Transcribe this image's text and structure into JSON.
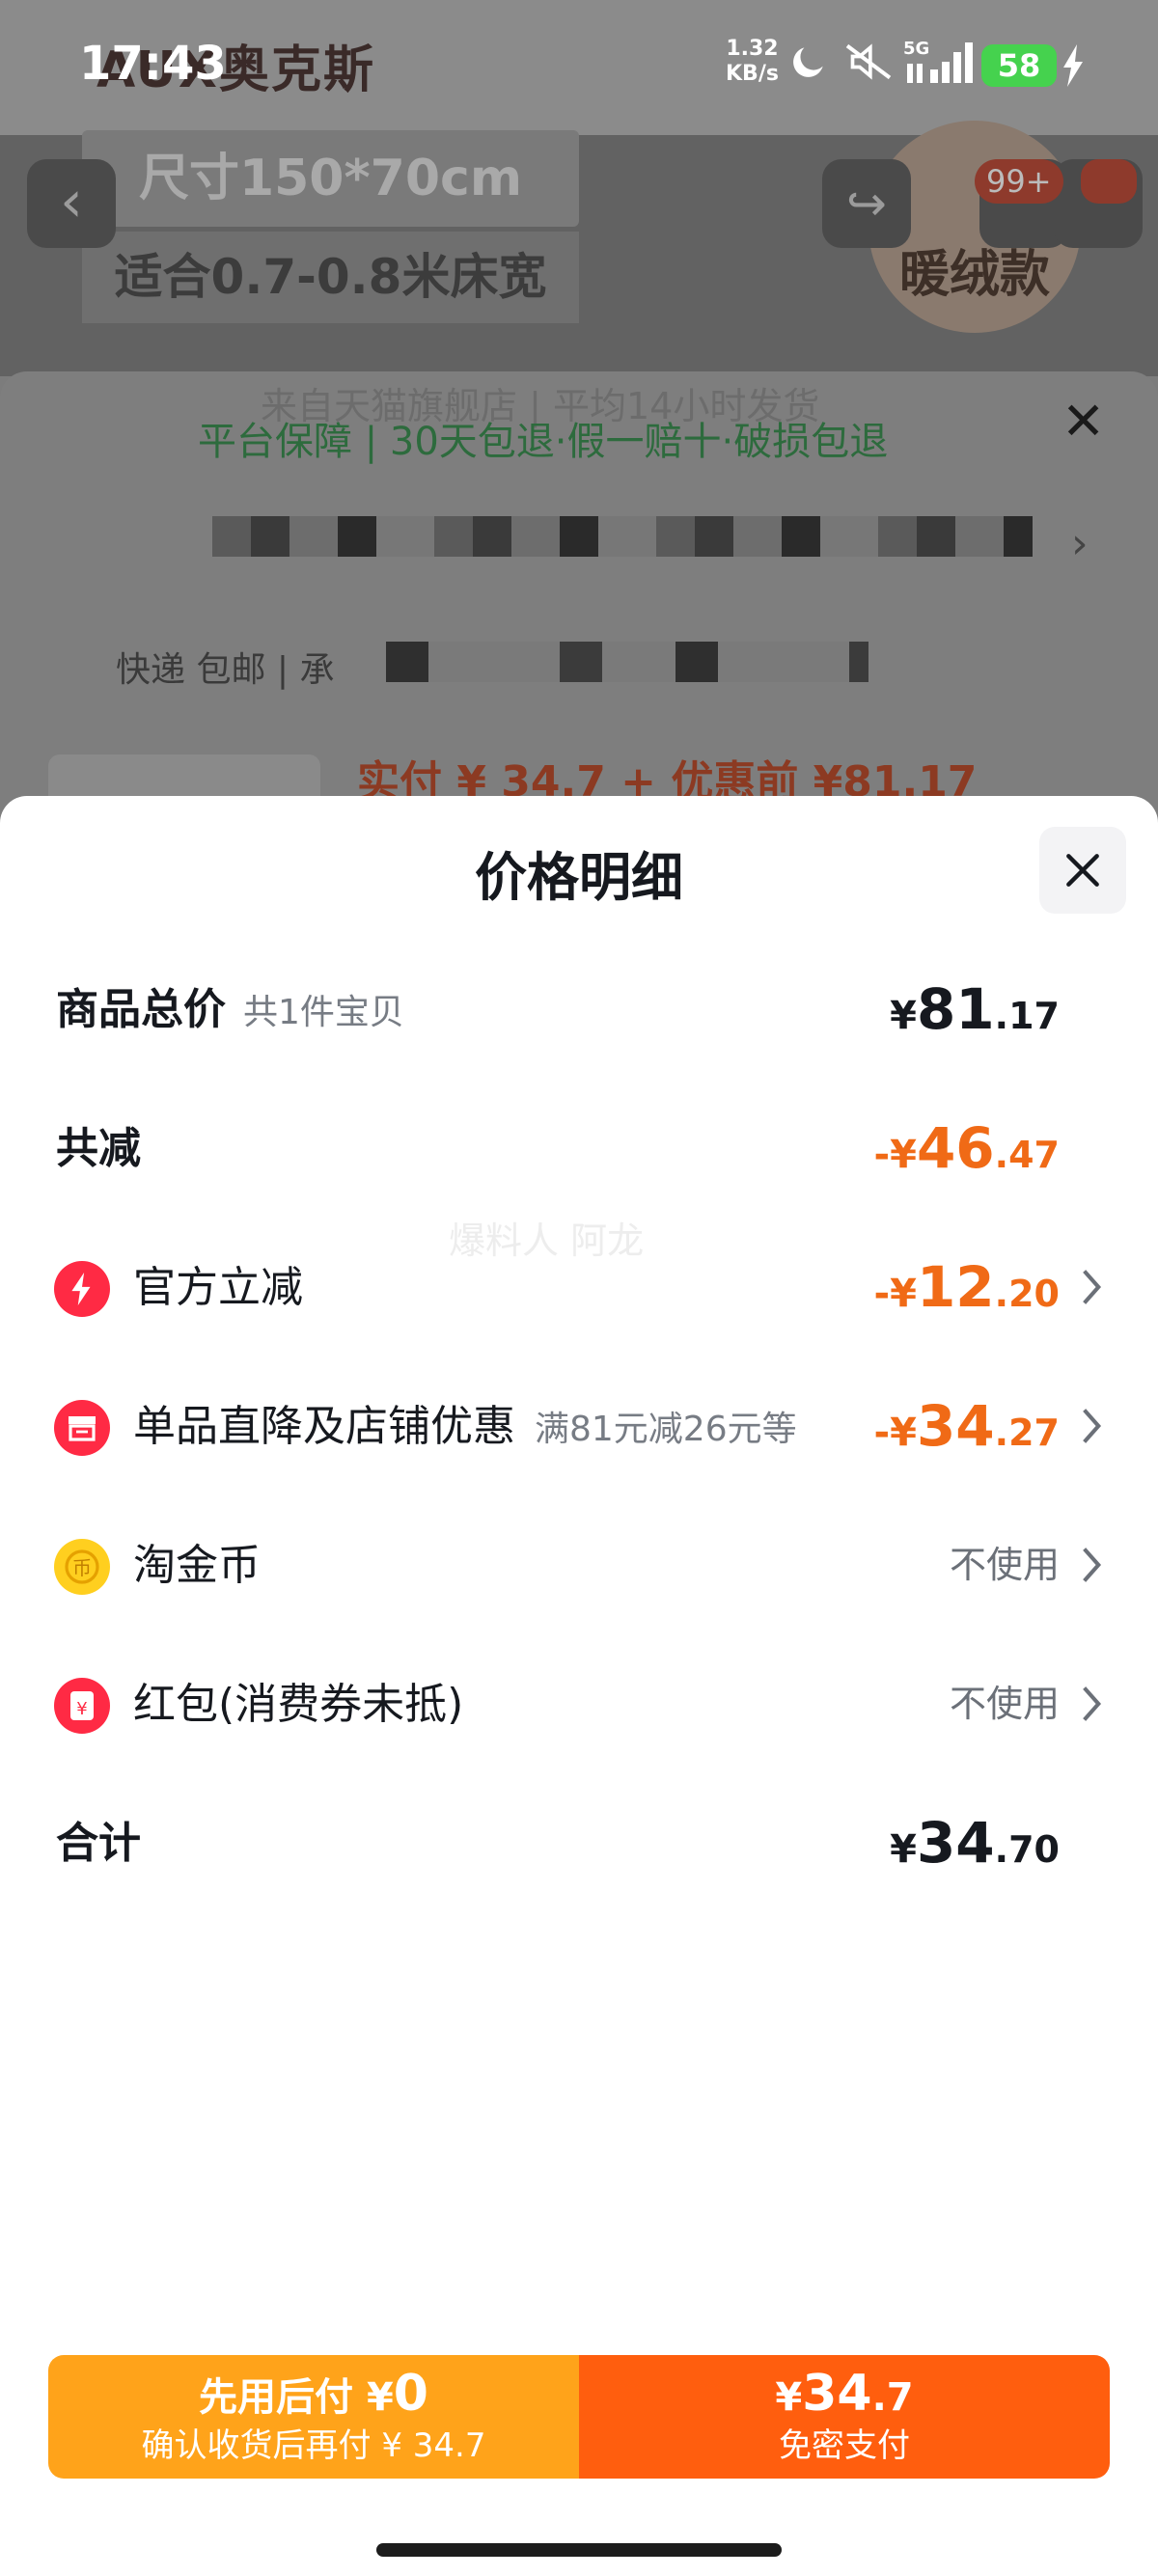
{
  "status_bar": {
    "time": "17:43",
    "net_speed_value": "1.32",
    "net_speed_unit": "KB/s",
    "network": "5G",
    "battery": "58"
  },
  "background": {
    "brand": "AUX奥克斯",
    "size_text": "尺寸150*70cm",
    "bed_text": "适合0.7-0.8米床宽",
    "style_badge": "暖绒款",
    "cart_badge": "99+",
    "shipping_text": "来自天猫旗舰店 | 平均14小时发货",
    "guarantee_text": "平台保障 | 30天包退·假一赔十·破损包退",
    "delivery_text": "快递 包邮 | 承",
    "brand_thumb": "AUX奥克斯",
    "price_preview": "实付 ¥ 34.7 + 优惠前 ¥81.17"
  },
  "modal": {
    "title": "价格明细",
    "watermark": "爆料人 阿龙",
    "total": {
      "label": "商品总价",
      "sub": "共1件宝贝",
      "symbol": "¥",
      "int": "81",
      "dec": ".17"
    },
    "discount": {
      "label": "共减",
      "symbol": "-¥",
      "int": "46",
      "dec": ".47"
    },
    "official": {
      "label": "官方立减",
      "symbol": "-¥",
      "int": "12",
      "dec": ".20",
      "icon": "lightning-icon"
    },
    "store": {
      "label": "单品直降及店铺优惠",
      "sub": "满81元减26元等",
      "symbol": "-¥",
      "int": "34",
      "dec": ".27",
      "icon": "store-icon"
    },
    "coins": {
      "label": "淘金币",
      "value": "不使用",
      "icon": "coin-icon"
    },
    "redpacket": {
      "label": "红包(消费券未抵)",
      "value": "不使用",
      "icon": "red-packet-icon"
    },
    "sum": {
      "label": "合计",
      "symbol": "¥",
      "int": "34",
      "dec": ".70"
    }
  },
  "action_bar": {
    "later": {
      "line1": "先用后付 ¥",
      "line1_amount": "0",
      "line2": "确认收货后再付 ¥ 34.7"
    },
    "pay": {
      "symbol": "¥",
      "int": "34",
      "dec": ".7",
      "line2": "免密支付"
    }
  },
  "colors": {
    "accent_orange": "#f06a16",
    "pay_button": "#ff5e0e",
    "later_button": "#ffa31a",
    "battery": "#45d24e"
  }
}
